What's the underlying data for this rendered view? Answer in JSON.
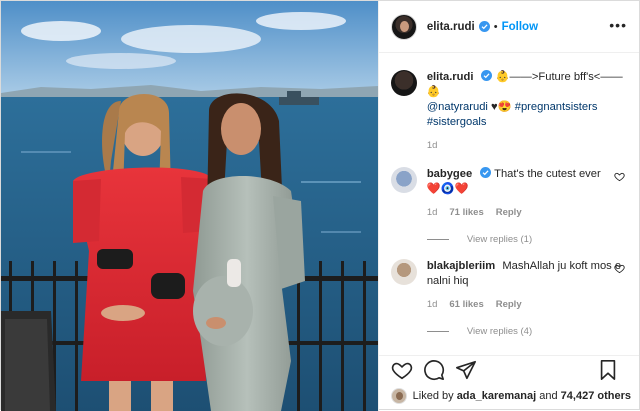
{
  "header": {
    "username": "elita.rudi",
    "separator": "•",
    "follow_label": "Follow",
    "more_label": "•••"
  },
  "caption": {
    "username": "elita.rudi",
    "text": "——>Future bff's<——",
    "mention": "@natyrarudi",
    "emojis_mid": "♥",
    "hashtag1": "#pregnantsisters",
    "hashtag2": "#sistergoals",
    "time": "1d"
  },
  "comments": [
    {
      "username": "babygee",
      "text": "That's the cutest ever",
      "emojis": "",
      "time": "1d",
      "likes": "71 likes",
      "reply_label": "Reply",
      "view_replies": "View replies (1)"
    },
    {
      "username": "blakajbleriim",
      "text": "MashAllah ju koft mos e nalni hiq",
      "time": "1d",
      "likes": "61 likes",
      "reply_label": "Reply",
      "view_replies": "View replies (4)"
    }
  ],
  "likes_line": {
    "prefix": "Liked by",
    "user": "ada_karemanaj",
    "and": "and",
    "others": "74,427 others"
  },
  "icons": [
    "verified-badge-icon",
    "heart-icon",
    "comment-icon",
    "share-icon",
    "bookmark-icon",
    "more-icon"
  ],
  "colors": {
    "link": "#00376b",
    "follow": "#0095f6",
    "verified": "#3897f0",
    "muted": "#8e8e8e"
  }
}
